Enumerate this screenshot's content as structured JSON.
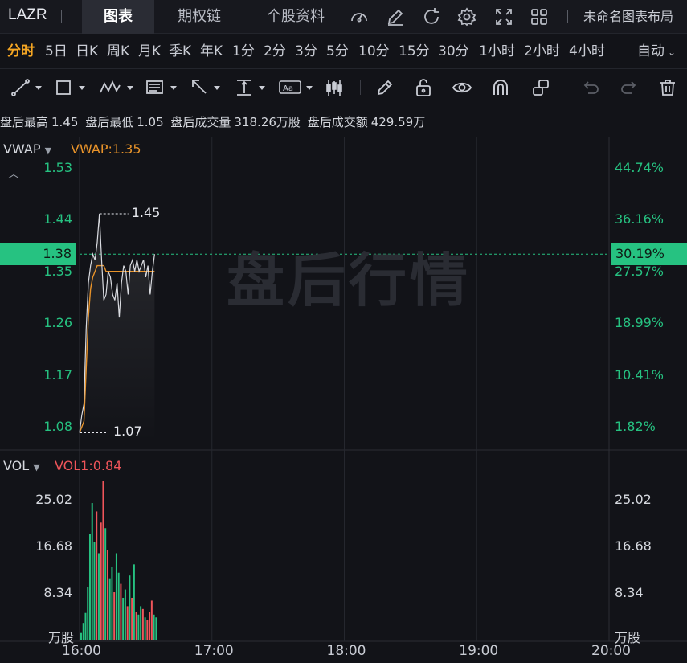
{
  "topbar": {
    "symbol": "LAZR",
    "tabs": [
      {
        "label": "图表",
        "active": true
      },
      {
        "label": "期权链",
        "active": false
      },
      {
        "label": "个股资料",
        "active": false
      }
    ],
    "icons": [
      "gauge-icon",
      "edit-icon",
      "refresh-icon",
      "settings-icon",
      "fullscreen-icon",
      "grid-layout-icon"
    ],
    "layout_name": "未命名图表布局"
  },
  "periods": [
    "分时",
    "5日",
    "日K",
    "周K",
    "月K",
    "季K",
    "年K",
    "1分",
    "2分",
    "3分",
    "5分",
    "10分",
    "15分",
    "30分",
    "1小时",
    "2小时",
    "4小时"
  ],
  "active_period": "分时",
  "auto_label": "自动",
  "drawing_tools": [
    "line-tool-icon",
    "rectangle-tool-icon",
    "pattern-tool-icon",
    "fib-tool-icon",
    "arrow-tool-icon",
    "text-measure-tool-icon",
    "text-annotation-tool-icon",
    "candle-tool-icon",
    "pencil-icon",
    "unlock-icon",
    "eye-icon",
    "magnet-icon",
    "layers-icon",
    "undo-icon",
    "redo-icon",
    "trash-icon"
  ],
  "stats": {
    "high_label": "盘后最高",
    "high": "1.45",
    "low_label": "盘后最低",
    "low": "1.05",
    "volume_label": "盘后成交量",
    "volume": "318.26万股",
    "amount_label": "盘后成交额",
    "amount": "429.59万"
  },
  "price_pane": {
    "indicator": "VWAP",
    "indicator_value": "VWAP:1.35",
    "watermark": "盘后行情",
    "current_price": "1.38",
    "current_pct": "30.19%",
    "high_marker": "1.45",
    "low_marker": "1.07",
    "y_ticks": [
      "1.53",
      "1.44",
      "1.35",
      "1.26",
      "1.17",
      "1.08"
    ],
    "pct_ticks": [
      "44.74%",
      "36.16%",
      "27.57%",
      "18.99%",
      "10.41%",
      "1.82%"
    ]
  },
  "volume_pane": {
    "indicator": "VOL",
    "indicator_value": "VOL1:0.84",
    "y_ticks": [
      "25.02",
      "16.68",
      "8.34"
    ],
    "unit": "万股"
  },
  "x_ticks": [
    "16:00",
    "17:00",
    "18:00",
    "19:00",
    "20:00"
  ],
  "colors": {
    "up": "#26c281",
    "down": "#f0555a",
    "vwap": "#e8932a",
    "price_line": "#d9dbe0",
    "accent": "#f5a623"
  },
  "chart_data": {
    "type": "line",
    "x_range": [
      "16:00",
      "20:00"
    ],
    "price": {
      "ylim": [
        1.04,
        1.57
      ],
      "times_minutes": [
        0,
        1,
        2,
        3,
        4,
        5,
        6,
        7,
        8,
        9,
        10,
        11,
        12,
        13,
        14,
        15,
        16,
        17,
        18,
        19,
        20,
        21,
        22,
        23,
        24,
        25,
        26,
        27,
        28,
        29,
        30,
        31,
        32,
        33,
        34
      ],
      "last": [
        1.07,
        1.1,
        1.12,
        1.25,
        1.33,
        1.36,
        1.38,
        1.37,
        1.4,
        1.45,
        1.37,
        1.3,
        1.31,
        1.35,
        1.34,
        1.31,
        1.3,
        1.33,
        1.27,
        1.33,
        1.36,
        1.35,
        1.31,
        1.36,
        1.37,
        1.35,
        1.37,
        1.35,
        1.36,
        1.37,
        1.34,
        1.36,
        1.31,
        1.35,
        1.38
      ],
      "vwap": [
        1.07,
        1.08,
        1.09,
        1.18,
        1.27,
        1.32,
        1.34,
        1.35,
        1.36,
        1.36,
        1.36,
        1.36,
        1.35,
        1.35,
        1.35,
        1.35,
        1.35,
        1.35,
        1.35,
        1.35,
        1.35,
        1.35,
        1.35,
        1.35,
        1.35,
        1.35,
        1.35,
        1.35,
        1.35,
        1.35,
        1.35,
        1.35,
        1.35,
        1.35,
        1.35
      ]
    },
    "volume": {
      "ylim": [
        0,
        32
      ],
      "unit": "万股",
      "values": [
        1.2,
        3.0,
        4.8,
        9.5,
        19.0,
        24.5,
        17.5,
        23.0,
        15.5,
        21.0,
        28.5,
        20.0,
        16.0,
        11.0,
        13.0,
        8.5,
        15.5,
        12.0,
        10.0,
        7.5,
        9.0,
        6.0,
        11.5,
        7.5,
        13.5,
        5.0,
        4.5,
        6.0,
        5.5,
        4.0,
        3.5,
        5.0,
        7.0,
        4.5,
        4.0
      ],
      "up": [
        true,
        true,
        true,
        true,
        true,
        true,
        true,
        false,
        true,
        false,
        false,
        true,
        false,
        true,
        true,
        false,
        true,
        true,
        false,
        true,
        true,
        false,
        true,
        false,
        true,
        false,
        true,
        true,
        false,
        true,
        false,
        false,
        false,
        true,
        true
      ]
    }
  }
}
